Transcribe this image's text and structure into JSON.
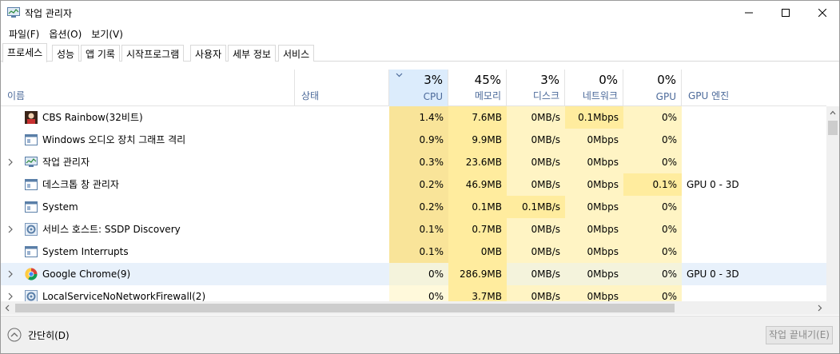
{
  "window": {
    "title": "작업 관리자"
  },
  "menu": [
    "파일(F)",
    "옵션(O)",
    "보기(V)"
  ],
  "tabs": [
    "프로세스",
    "성능",
    "앱 기록",
    "시작프로그램",
    "사용자",
    "세부 정보",
    "서비스"
  ],
  "columns": {
    "name": "이름",
    "status": "상태",
    "cpu": {
      "pct": "3%",
      "label": "CPU"
    },
    "memory": {
      "pct": "45%",
      "label": "메모리"
    },
    "disk": {
      "pct": "3%",
      "label": "디스크"
    },
    "network": {
      "pct": "0%",
      "label": "네트워크"
    },
    "gpu": {
      "pct": "0%",
      "label": "GPU"
    },
    "gpu_engine": "GPU 엔진"
  },
  "processes": [
    {
      "name": "CBS Rainbow(32비트)",
      "icon": "cbs-icon",
      "expandable": false,
      "cpu": "1.4%",
      "memory": "7.6MB",
      "disk": "0MB/s",
      "network": "0.1Mbps",
      "gpu": "0%",
      "gpu_engine": ""
    },
    {
      "name": "Windows 오디오 장치 그래프 격리",
      "icon": "window-app-icon",
      "expandable": false,
      "cpu": "0.9%",
      "memory": "9.9MB",
      "disk": "0MB/s",
      "network": "0Mbps",
      "gpu": "0%",
      "gpu_engine": ""
    },
    {
      "name": "작업 관리자",
      "icon": "task-manager-icon",
      "expandable": true,
      "cpu": "0.3%",
      "memory": "23.6MB",
      "disk": "0MB/s",
      "network": "0Mbps",
      "gpu": "0%",
      "gpu_engine": ""
    },
    {
      "name": "데스크톱 창 관리자",
      "icon": "window-app-icon",
      "expandable": false,
      "cpu": "0.2%",
      "memory": "46.9MB",
      "disk": "0MB/s",
      "network": "0Mbps",
      "gpu": "0.1%",
      "gpu_engine": "GPU 0 - 3D"
    },
    {
      "name": "System",
      "icon": "window-app-icon",
      "expandable": false,
      "cpu": "0.2%",
      "memory": "0.1MB",
      "disk": "0.1MB/s",
      "network": "0Mbps",
      "gpu": "0%",
      "gpu_engine": ""
    },
    {
      "name": "서비스 호스트: SSDP Discovery",
      "icon": "gear-icon",
      "expandable": true,
      "cpu": "0.1%",
      "memory": "0.7MB",
      "disk": "0MB/s",
      "network": "0Mbps",
      "gpu": "0%",
      "gpu_engine": ""
    },
    {
      "name": "System Interrupts",
      "icon": "window-app-icon",
      "expandable": false,
      "cpu": "0.1%",
      "memory": "0MB",
      "disk": "0MB/s",
      "network": "0Mbps",
      "gpu": "0%",
      "gpu_engine": ""
    },
    {
      "name": "Google Chrome(9)",
      "icon": "chrome-icon",
      "expandable": true,
      "cpu": "0%",
      "memory": "286.9MB",
      "disk": "0MB/s",
      "network": "0Mbps",
      "gpu": "0%",
      "gpu_engine": "GPU 0 - 3D"
    },
    {
      "name": "LocalServiceNoNetworkFirewall(2)",
      "icon": "gear-icon",
      "expandable": true,
      "cpu": "0%",
      "memory": "3.7MB",
      "disk": "0MB/s",
      "network": "0Mbps",
      "gpu": "0%",
      "gpu_engine": ""
    }
  ],
  "footer": {
    "collapse_label": "간단히(D)",
    "end_task_label": "작업 끝내기(E)"
  },
  "colors": {
    "heat_light": "#fff4c4",
    "heat_medium": "#ffec9e",
    "heat_strong": "#f9e499",
    "selected_row": "#e8f1fb",
    "sorted_header": "#dcecfc",
    "header_label": "#4c6a9a"
  }
}
